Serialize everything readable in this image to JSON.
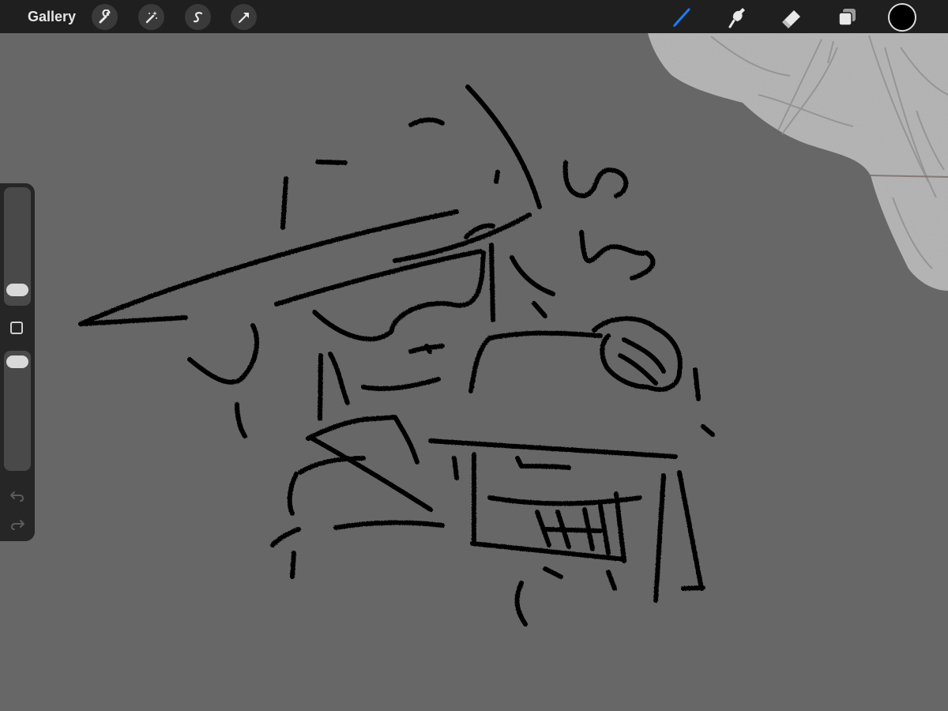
{
  "toolbar": {
    "gallery_label": "Gallery",
    "left_tools": [
      {
        "name": "actions",
        "icon": "wrench-icon"
      },
      {
        "name": "adjustments",
        "icon": "magic-wand-icon"
      },
      {
        "name": "selection",
        "icon": "selection-s-icon"
      },
      {
        "name": "transform",
        "icon": "arrow-cursor-icon"
      }
    ],
    "right_tools": [
      {
        "name": "brush",
        "icon": "brush-icon",
        "active": true
      },
      {
        "name": "smudge",
        "icon": "smudge-icon",
        "active": false
      },
      {
        "name": "eraser",
        "icon": "eraser-icon",
        "active": false
      },
      {
        "name": "layers",
        "icon": "layers-icon",
        "active": false
      }
    ],
    "active_color": "#000000",
    "accent_color": "#1a7cff"
  },
  "sidebar": {
    "brush_size_level": 0.1,
    "opacity_level": 1.0,
    "icons": [
      "modify-square-icon",
      "undo-icon",
      "redo-icon"
    ]
  },
  "canvas": {
    "background_color": "#676767",
    "stroke_color": "#000000",
    "reference_layer_color": "#b0b0b0"
  }
}
